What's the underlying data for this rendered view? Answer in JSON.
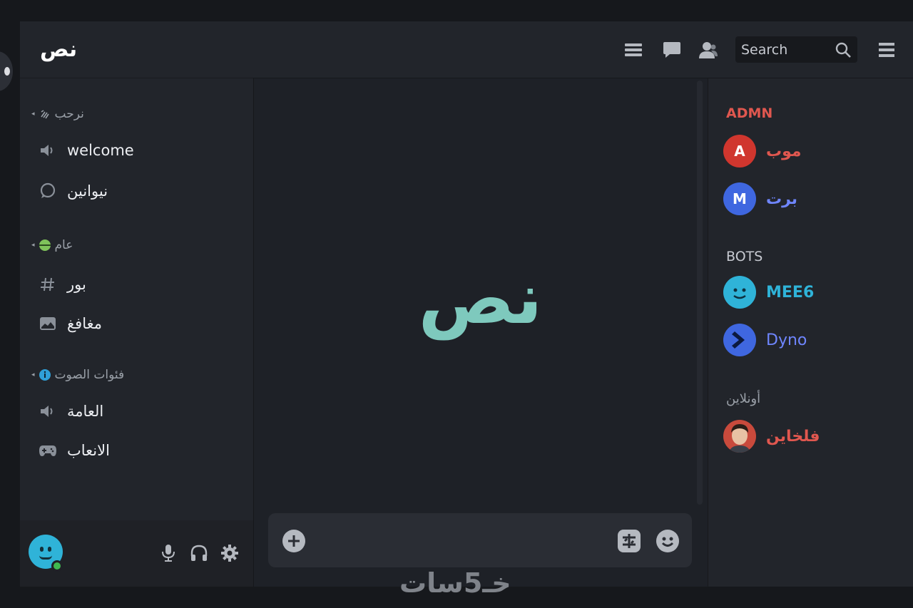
{
  "server": {
    "name": "نص"
  },
  "categories": [
    {
      "label": "نرحب",
      "icon": "wave-icon",
      "channels": [
        {
          "label": "welcome",
          "icon": "speaker-icon"
        },
        {
          "label": "نيوانين",
          "icon": "chat-bubble-icon"
        }
      ]
    },
    {
      "label": "عام",
      "icon": "green-dot-icon",
      "channels": [
        {
          "label": "بور",
          "icon": "hash-icon"
        },
        {
          "label": "مغافغ",
          "icon": "image-icon"
        }
      ]
    },
    {
      "label": "فئوات الصوت",
      "icon": "info-icon",
      "channels": [
        {
          "label": "العامة",
          "icon": "speaker-icon"
        },
        {
          "label": "الانعاب",
          "icon": "gamepad-icon"
        }
      ]
    }
  ],
  "topbar": {
    "search_placeholder": "Search",
    "icons": [
      "threads-icon",
      "chat-icon",
      "members-icon",
      "search-icon",
      "menu-icon"
    ]
  },
  "main": {
    "content_text": "نص"
  },
  "composer": {
    "add_icon": "plus-icon",
    "gif_icon": "sticker-icon",
    "emoji_icon": "emoji-icon"
  },
  "members": {
    "roles": [
      {
        "label": "ADMN",
        "color": "#e0574f",
        "members": [
          {
            "initial": "A",
            "name": "موب",
            "avatar_color": "#d0362e",
            "name_color": "#e0574f"
          },
          {
            "initial": "M",
            "name": "برت",
            "avatar_color": "#3f67e0",
            "name_color": "#6f86ff"
          }
        ]
      },
      {
        "label": "BOTS",
        "color": "#c7cad1",
        "members": [
          {
            "initial": "",
            "name": "MEE6",
            "avatar_color": "#2fb3d8",
            "name_color": "#2fb3d8",
            "avatar_icon": "smiley-icon"
          },
          {
            "initial": "",
            "name": "Dyno",
            "avatar_color": "#3f67e0",
            "name_color": "#6f86ff",
            "avatar_icon": "chevron-icon"
          }
        ]
      },
      {
        "label": "أونلاين",
        "color": "#9aa0a8",
        "members": [
          {
            "initial": "",
            "name": "فلخاين",
            "avatar_color": "#c94a3c",
            "name_color": "#e0574f",
            "avatar_icon": "person-photo"
          }
        ]
      }
    ]
  },
  "user_panel": {
    "status": "online",
    "status_color": "#3fb950"
  },
  "watermark": "خـ5سات"
}
